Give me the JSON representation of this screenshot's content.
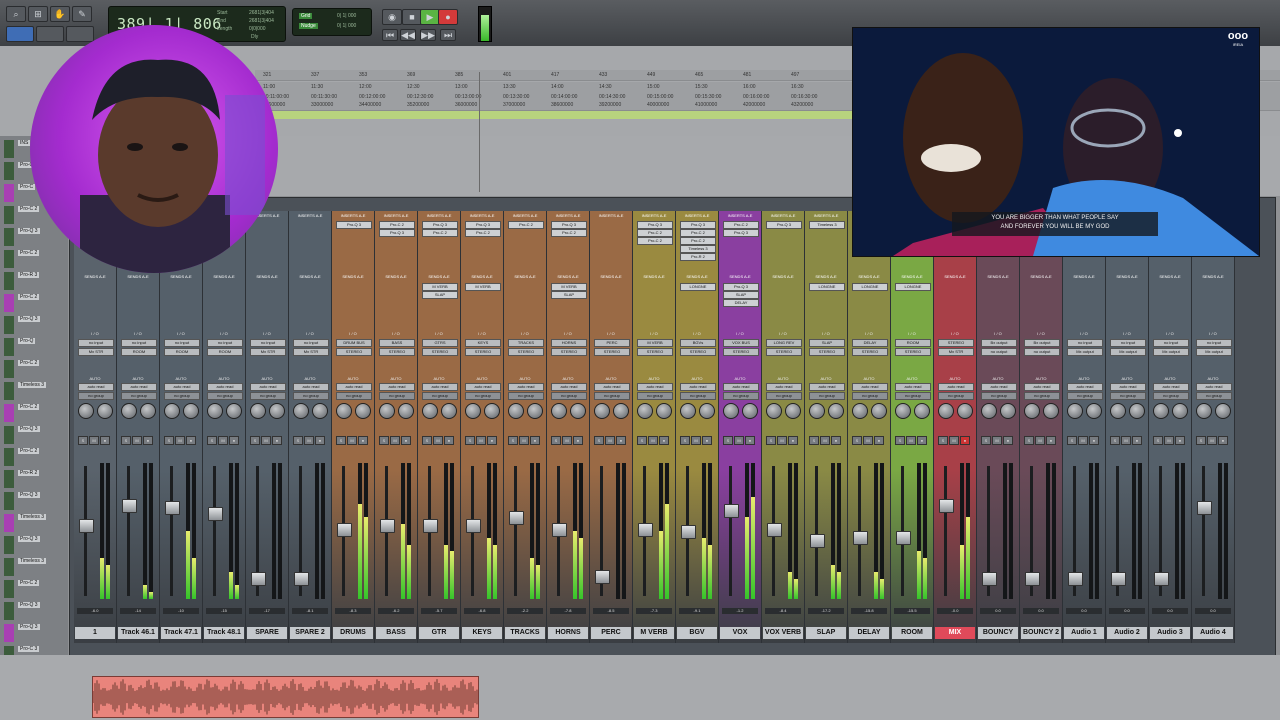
{
  "transport": {
    "counter": "389| 1| 806",
    "start_label": "Start",
    "end_label": "End",
    "length_label": "Length",
    "start_value": "2681|3|404",
    "end_value": "2681|3|404",
    "length_value": "0|0|000",
    "grid_label": "Grid",
    "nudge_label": "Nudge",
    "grid_value": "0| 1| 000",
    "nudge_value": "0| 1| 000",
    "dly_label": "Dly",
    "pre_value": "0|0|000"
  },
  "ruler": {
    "bars": [
      "321",
      "337",
      "353",
      "369",
      "385",
      "401",
      "417",
      "433",
      "449",
      "465",
      "481",
      "497"
    ],
    "times": [
      "11:00",
      "11:30",
      "12:00",
      "12:30",
      "13:00",
      "13:30",
      "14:00",
      "14:30",
      "15:00",
      "15:30",
      "16:00",
      "16:30"
    ],
    "timecodes": [
      "00:11:00:00",
      "00:11:30:00",
      "00:12:00:00",
      "00:12:30:00",
      "00:13:00:00",
      "00:13:30:00",
      "00:14:00:00",
      "00:14:30:00",
      "00:15:00:00",
      "00:15:30:00",
      "00:16:00:00",
      "00:16:30:00"
    ],
    "samples": [
      "32600000",
      "33000000",
      "34400000",
      "35200000",
      "36000000",
      "37000000",
      "38600000",
      "39200000",
      "40000000",
      "41000000",
      "42000000",
      "43200000"
    ]
  },
  "left_column": {
    "labels": [
      "INS",
      "Pro-Q",
      "Pro-C",
      "Pro-C 2",
      "Pro-Q 3",
      "Pro-C 2",
      "Pro-R 3",
      "Pro-C 2",
      "Pro-Q 3",
      "Pro-Q",
      "Pro-C 2",
      "Timeless 3",
      "Pro-C 2",
      "Pro-Q 3",
      "Pro-C 2",
      "Pro-R 2",
      "Pro-Q 3",
      "Timeless 3",
      "Pro-Q 3",
      "Timeless 3",
      "Pro-C 2",
      "Pro-Q 3",
      "Pro-Q 3",
      "Pro-C 3"
    ]
  },
  "mixer": {
    "inserts_label": "INSERTS A-E",
    "sends_label": "SENDS A-E",
    "io_label": "I / O",
    "auto_label": "AUTO",
    "group_label": "no group",
    "strips": [
      {
        "name": "1",
        "color": "#5a636c",
        "in": "no input",
        "out": "Mx STR",
        "auto": "auto read",
        "inserts": [],
        "sends": [],
        "vol": "-6.0",
        "fader": 0.55,
        "m1": 0.3,
        "m2": 0.25
      },
      {
        "name": "Track 46.1",
        "color": "#55606a",
        "in": "no input",
        "out": "ROOM",
        "auto": "auto read",
        "inserts": [],
        "sends": [],
        "vol": "-14",
        "fader": 0.72,
        "m1": 0.1,
        "m2": 0.05
      },
      {
        "name": "Track 47.1",
        "color": "#55606a",
        "in": "no input",
        "out": "ROOM",
        "auto": "auto read",
        "inserts": [],
        "sends": [],
        "vol": "-10",
        "fader": 0.7,
        "m1": 0.5,
        "m2": 0.3
      },
      {
        "name": "Track 48.1",
        "color": "#55606a",
        "in": "no input",
        "out": "ROOM",
        "auto": "auto read",
        "inserts": [],
        "sends": [],
        "vol": "-15",
        "fader": 0.65,
        "m1": 0.2,
        "m2": 0.1
      },
      {
        "name": "SPARE",
        "color": "#55606a",
        "in": "no input",
        "out": "Mx STR",
        "auto": "auto read",
        "inserts": [],
        "sends": [],
        "vol": "-17",
        "fader": 0.1,
        "m1": 0,
        "m2": 0
      },
      {
        "name": "SPARE 2",
        "color": "#55606a",
        "in": "no input",
        "out": "Mx STR",
        "auto": "auto read",
        "inserts": [],
        "sends": [],
        "vol": "-8.1",
        "fader": 0.1,
        "m1": 0,
        "m2": 0
      },
      {
        "name": "DRUMS",
        "color": "#9a6a45",
        "in": "DRUM BUS",
        "out": "STEREO",
        "auto": "auto read",
        "inserts": [
          "Pro-Q 3"
        ],
        "sends": [],
        "vol": "-8.3",
        "fader": 0.52,
        "m1": 0.7,
        "m2": 0.6
      },
      {
        "name": "BASS",
        "color": "#9a6a45",
        "in": "BASS",
        "out": "STEREO",
        "auto": "auto read",
        "inserts": [
          "Pro-C 2",
          "Pro-Q 3"
        ],
        "sends": [],
        "vol": "-6.2",
        "fader": 0.55,
        "m1": 0.55,
        "m2": 0.4
      },
      {
        "name": "GTR",
        "color": "#9a6a45",
        "in": "GTRS",
        "out": "STEREO",
        "auto": "auto read",
        "inserts": [
          "Pro-Q 3",
          "Pro-C 2"
        ],
        "sends": [
          "M VERB",
          "SLAP"
        ],
        "vol": "-5.7",
        "fader": 0.55,
        "m1": 0.4,
        "m2": 0.35
      },
      {
        "name": "KEYS",
        "color": "#9a6a45",
        "in": "KEYS",
        "out": "STEREO",
        "auto": "auto read",
        "inserts": [
          "Pro-Q 3",
          "Pro-C 2"
        ],
        "sends": [
          "M VERB"
        ],
        "vol": "-6.8",
        "fader": 0.55,
        "m1": 0.45,
        "m2": 0.4
      },
      {
        "name": "TRACKS",
        "color": "#9a6a45",
        "in": "TRACKS",
        "out": "STEREO",
        "auto": "auto read",
        "inserts": [
          "Pro-C 2"
        ],
        "sends": [],
        "vol": "-2.2",
        "fader": 0.62,
        "m1": 0.3,
        "m2": 0.25
      },
      {
        "name": "HORNS",
        "color": "#9a6a45",
        "in": "HORNS",
        "out": "STEREO",
        "auto": "auto read",
        "inserts": [
          "Pro-Q 3",
          "Pro-C 2"
        ],
        "sends": [
          "M VERB",
          "SLAP"
        ],
        "vol": "-7.8",
        "fader": 0.52,
        "m1": 0.5,
        "m2": 0.45
      },
      {
        "name": "PERC",
        "color": "#9a6a45",
        "in": "PERC",
        "out": "STEREO",
        "auto": "auto read",
        "inserts": [],
        "sends": [],
        "vol": "-8.5",
        "fader": 0.12,
        "m1": 0,
        "m2": 0
      },
      {
        "name": "M VERB",
        "color": "#9a8a40",
        "in": "M VERB",
        "out": "STEREO",
        "auto": "auto read",
        "inserts": [
          "Pro-Q 3",
          "Pro-C 2",
          "Pro-C 2"
        ],
        "sends": [],
        "vol": "-7.3",
        "fader": 0.52,
        "m1": 0.5,
        "m2": 0.7
      },
      {
        "name": "BGV",
        "color": "#9a8a40",
        "in": "BGVs",
        "out": "STEREO",
        "auto": "auto read",
        "inserts": [
          "Pro-Q 3",
          "Pro-C 2",
          "Pro-C 2",
          "Timeless 3",
          "Pro-R 2"
        ],
        "sends": [
          "LONGNE"
        ],
        "vol": "-9.1",
        "fader": 0.5,
        "m1": 0.45,
        "m2": 0.4
      },
      {
        "name": "VOX",
        "color": "#8a3fa0",
        "in": "VOX BUS",
        "out": "STEREO",
        "auto": "auto read",
        "inserts": [
          "Pro-C 2",
          "Pro-Q 3"
        ],
        "sends": [
          "Pro-Q 3",
          "SLAP",
          "DELAY"
        ],
        "vol": "-1.2",
        "fader": 0.68,
        "m1": 0.6,
        "m2": 0.75
      },
      {
        "name": "VOX VERB",
        "color": "#8a8a45",
        "in": "LONG REV",
        "out": "STEREO",
        "auto": "auto read",
        "inserts": [
          "Pro-Q 3"
        ],
        "sends": [],
        "vol": "-8.4",
        "fader": 0.52,
        "m1": 0.2,
        "m2": 0.15
      },
      {
        "name": "SLAP",
        "color": "#8a8a45",
        "in": "SLAP",
        "out": "STEREO",
        "auto": "auto read",
        "inserts": [
          "Timeless 3"
        ],
        "sends": [
          "LONGNE"
        ],
        "vol": "-17.2",
        "fader": 0.42,
        "m1": 0.25,
        "m2": 0.2
      },
      {
        "name": "DELAY",
        "color": "#8a8a45",
        "in": "DELAY",
        "out": "STEREO",
        "auto": "auto read",
        "inserts": [
          "Timeless 3",
          "Pro-Q 3"
        ],
        "sends": [
          "LONGNE"
        ],
        "vol": "-15.8",
        "fader": 0.45,
        "m1": 0.2,
        "m2": 0.15
      },
      {
        "name": "ROOM",
        "color": "#7aa844",
        "in": "ROOM",
        "out": "STEREO",
        "auto": "auto read",
        "inserts": [],
        "sends": [
          "LONGNE"
        ],
        "vol": "-15.5",
        "fader": 0.45,
        "m1": 0.35,
        "m2": 0.3
      },
      {
        "name": "MIX",
        "color": "#a84048",
        "in": "STEREO",
        "out": "Mx STR",
        "auto": "auto read",
        "inserts": [
          "Pro-Q 3"
        ],
        "sends": [],
        "vol": "-0.0",
        "fader": 0.72,
        "m1": 0.4,
        "m2": 0.6
      },
      {
        "name": "BOUNCY",
        "color": "#6a4a58",
        "in": "Bx output",
        "out": "no output",
        "auto": "auto read",
        "inserts": [],
        "sends": [],
        "vol": "0.0",
        "fader": 0.1,
        "m1": 0,
        "m2": 0
      },
      {
        "name": "BOUNCY 2",
        "color": "#6a4a58",
        "in": "Bx output",
        "out": "no output",
        "auto": "auto read",
        "inserts": [],
        "sends": [],
        "vol": "0.0",
        "fader": 0.1,
        "m1": 0,
        "m2": 0
      },
      {
        "name": "Audio 1",
        "color": "#55606a",
        "in": "no input",
        "out": "Mx output",
        "auto": "auto read",
        "inserts": [],
        "sends": [],
        "vol": "0.0",
        "fader": 0.1,
        "m1": 0,
        "m2": 0
      },
      {
        "name": "Audio 2",
        "color": "#55606a",
        "in": "no input",
        "out": "Mx output",
        "auto": "auto read",
        "inserts": [],
        "sends": [],
        "vol": "0.0",
        "fader": 0.1,
        "m1": 0,
        "m2": 0
      },
      {
        "name": "Audio 3",
        "color": "#55606a",
        "in": "no input",
        "out": "Mx output",
        "auto": "auto read",
        "inserts": [],
        "sends": [],
        "vol": "0.0",
        "fader": 0.1,
        "m1": 0,
        "m2": 0
      },
      {
        "name": "Audio 4",
        "color": "#55606a",
        "in": "no input",
        "out": "Mx output",
        "auto": "auto read",
        "inserts": [],
        "sends": [],
        "vol": "0.0",
        "fader": 0.7,
        "m1": 0,
        "m2": 0
      }
    ]
  },
  "video": {
    "subtitle_line1": "YOU ARE BIGGER THAN WHAT PEOPLE SAY",
    "subtitle_line2": "AND FOREVER YOU WILL BE MY GOD",
    "logo": "ooo",
    "logo_sub": "IREIA"
  }
}
